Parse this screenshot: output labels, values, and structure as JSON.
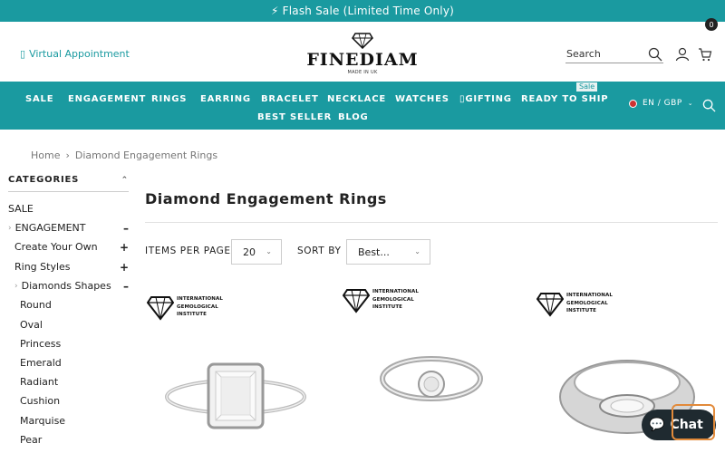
{
  "announcement": "⚡ Flash Sale (Limited Time Only)",
  "header": {
    "appointment_label": "Virtual Appointment",
    "logo_name": "FINEDIAM",
    "logo_sub": "MADE IN UK",
    "search_placeholder": "Search",
    "cart_count": "0"
  },
  "nav": {
    "items": [
      "SALE",
      "ENGAGEMENT",
      "RINGS",
      "EARRING",
      "BRACELET",
      "NECKLACE",
      "WATCHES",
      "GIFTING",
      "READY TO SHIP",
      "BEST SELLER",
      "BLOG"
    ],
    "sale_badge": "Sale",
    "language": "EN / GBP"
  },
  "breadcrumb": {
    "home": "Home",
    "sep": "›",
    "current": "Diamond Engagement Rings"
  },
  "sidebar": {
    "title": "CATEGORIES",
    "items": [
      {
        "label": "SALE",
        "sign": ""
      },
      {
        "label": "ENGAGEMENT",
        "sign": "–"
      },
      {
        "label": "Create Your Own",
        "sign": "+"
      },
      {
        "label": "Ring Styles",
        "sign": "+"
      },
      {
        "label": "Diamonds Shapes",
        "sign": "–"
      },
      {
        "label": "Round",
        "sign": ""
      },
      {
        "label": "Oval",
        "sign": ""
      },
      {
        "label": "Princess",
        "sign": ""
      },
      {
        "label": "Emerald",
        "sign": ""
      },
      {
        "label": "Radiant",
        "sign": ""
      },
      {
        "label": "Cushion",
        "sign": ""
      },
      {
        "label": "Marquise",
        "sign": ""
      },
      {
        "label": "Pear",
        "sign": ""
      }
    ]
  },
  "main": {
    "title": "Diamond Engagement Rings",
    "items_per_page_label": "ITEMS PER PAGE",
    "items_per_page_value": "20",
    "sort_by_label": "SORT BY",
    "sort_by_value": "Best..."
  },
  "igi": {
    "line1": "INTERNATIONAL",
    "line2": "GEMOLOGICAL",
    "line3": "INSTITUTE"
  },
  "chat": {
    "label": "Chat"
  },
  "colors": {
    "accent": "#1a9aa0",
    "dark": "#1f2a30"
  }
}
